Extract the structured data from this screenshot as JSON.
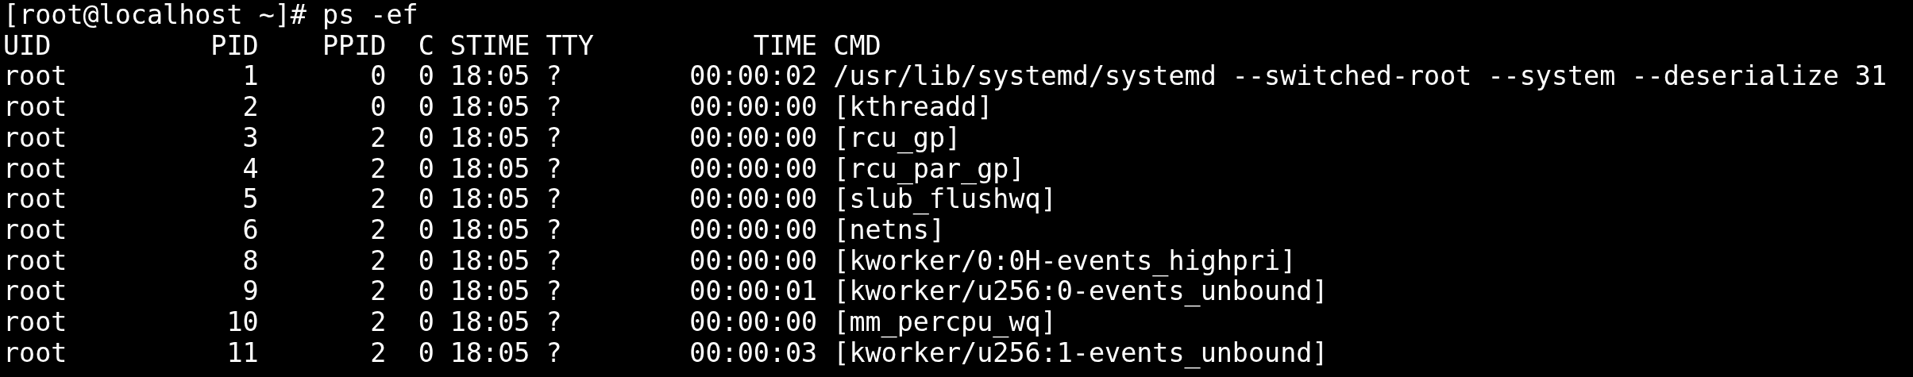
{
  "prompt": "[root@localhost ~]# ps -ef",
  "columns": [
    "UID",
    "PID",
    "PPID",
    "C",
    "STIME",
    "TTY",
    "TIME",
    "CMD"
  ],
  "rows": [
    [
      "root",
      "1",
      "0",
      "0",
      "18:05",
      "?",
      "00:00:02",
      "/usr/lib/systemd/systemd --switched-root --system --deserialize 31"
    ],
    [
      "root",
      "2",
      "0",
      "0",
      "18:05",
      "?",
      "00:00:00",
      "[kthreadd]"
    ],
    [
      "root",
      "3",
      "2",
      "0",
      "18:05",
      "?",
      "00:00:00",
      "[rcu_gp]"
    ],
    [
      "root",
      "4",
      "2",
      "0",
      "18:05",
      "?",
      "00:00:00",
      "[rcu_par_gp]"
    ],
    [
      "root",
      "5",
      "2",
      "0",
      "18:05",
      "?",
      "00:00:00",
      "[slub_flushwq]"
    ],
    [
      "root",
      "6",
      "2",
      "0",
      "18:05",
      "?",
      "00:00:00",
      "[netns]"
    ],
    [
      "root",
      "8",
      "2",
      "0",
      "18:05",
      "?",
      "00:00:00",
      "[kworker/0:0H-events_highpri]"
    ],
    [
      "root",
      "9",
      "2",
      "0",
      "18:05",
      "?",
      "00:00:01",
      "[kworker/u256:0-events_unbound]"
    ],
    [
      "root",
      "10",
      "2",
      "0",
      "18:05",
      "?",
      "00:00:00",
      "[mm_percpu_wq]"
    ],
    [
      "root",
      "11",
      "2",
      "0",
      "18:05",
      "?",
      "00:00:03",
      "[kworker/u256:1-events_unbound]"
    ]
  ]
}
